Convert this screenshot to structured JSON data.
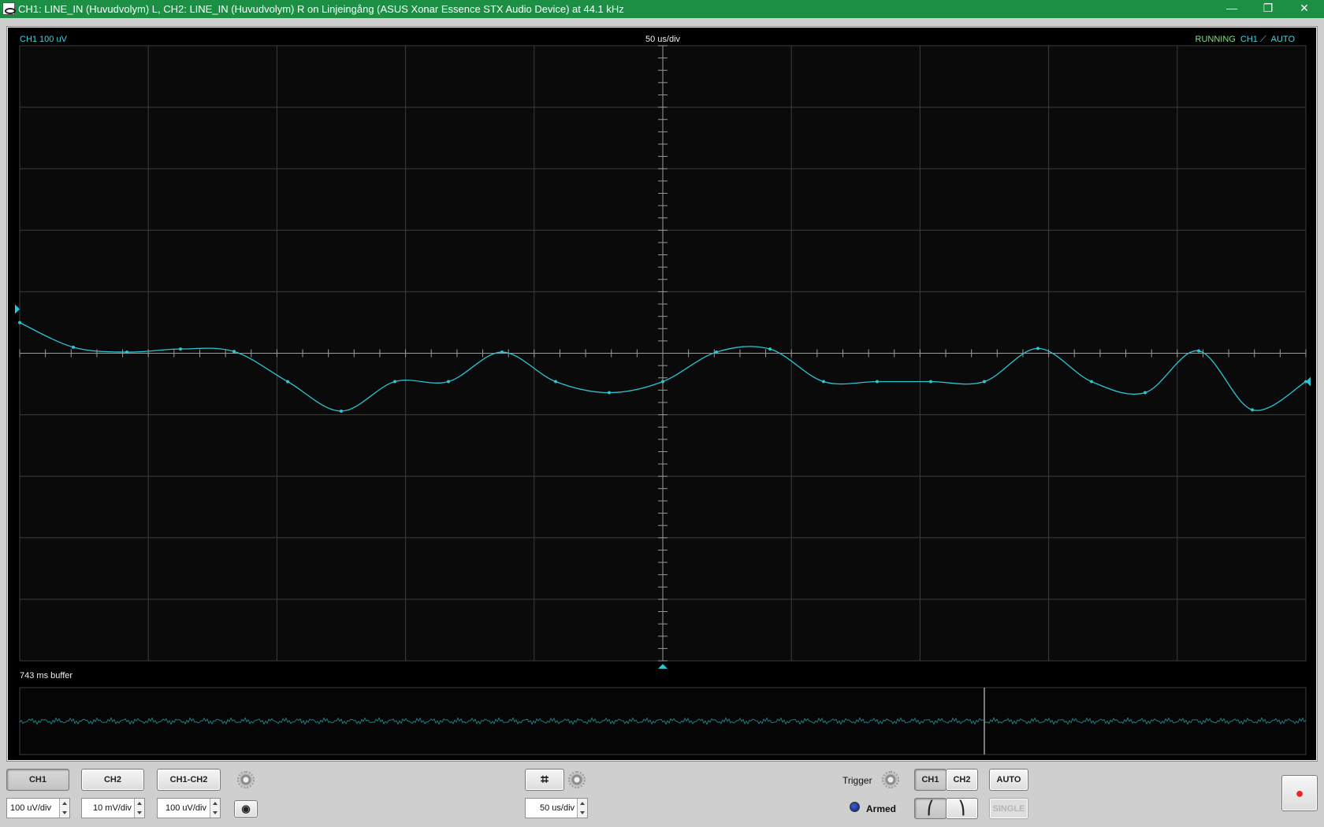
{
  "window": {
    "title": "CH1: LINE_IN (Huvudvolym) L, CH2: LINE_IN (Huvudvolym) R on Linjeingång (ASUS Xonar Essence STX Audio Device) at 44.1 kHz",
    "minimize_glyph": "—",
    "maximize_glyph": "❐",
    "close_glyph": "✕"
  },
  "scope": {
    "ch1_scale": "CH1 100 uV",
    "timebase": "50 us/div",
    "status": "RUNNING",
    "trigger_channel": "CH1 ⟋",
    "trigger_mode": "AUTO",
    "buffer_label": "743 ms buffer",
    "trace_color": "#29c6d4",
    "grid_divisions": {
      "x": 10,
      "y": 10
    },
    "trace_samples": [
      0.48,
      0.08,
      0.0,
      0.05,
      0.01,
      -0.48,
      -0.96,
      -0.48,
      -0.48,
      0.0,
      -0.48,
      -0.66,
      -0.48,
      0.0,
      0.05,
      -0.48,
      -0.48,
      -0.48,
      -0.48,
      0.06,
      -0.48,
      -0.66,
      0.02,
      -0.94,
      -0.48
    ],
    "buffer_window_fraction": 0.75
  },
  "controls": {
    "ch1_label": "CH1",
    "ch2_label": "CH2",
    "diff_label": "CH1-CH2",
    "ch1_vdiv": "100 uV/div",
    "ch2_vdiv": "10 mV/div",
    "diff_vdiv": "100 uV/div",
    "timebase_value": "50 us/div",
    "trigger_label": "Trigger",
    "trig_ch1": "CH1",
    "trig_ch2": "CH2",
    "auto_label": "AUTO",
    "single_label": "SINGLE",
    "armed_label": "Armed",
    "rising_glyph": "⎛",
    "falling_glyph": "⎞",
    "cursor_glyph": "⌗",
    "camera_glyph": "◉",
    "record_glyph": "●"
  }
}
